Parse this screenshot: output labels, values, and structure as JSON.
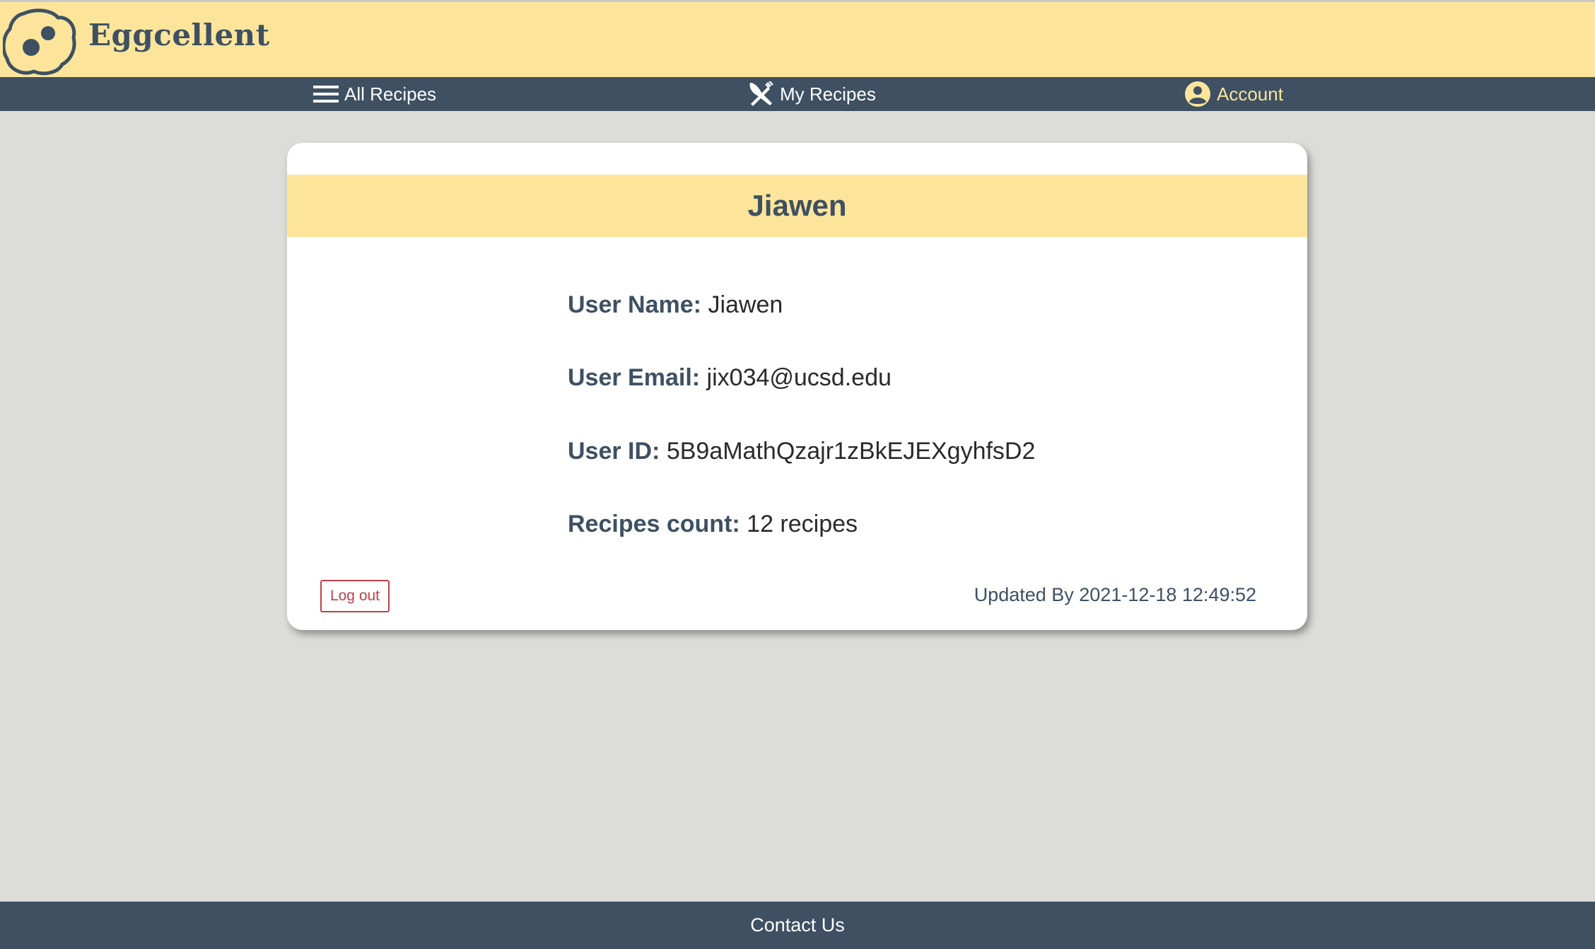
{
  "brand": {
    "name": "Eggcellent",
    "logo_icon": "egg-logo-icon"
  },
  "nav": {
    "items": [
      {
        "label": "All Recipes",
        "icon": "menu-icon",
        "active": false
      },
      {
        "label": "My Recipes",
        "icon": "utensils-icon",
        "active": false
      },
      {
        "label": "Account",
        "icon": "user-circle-icon",
        "active": true
      }
    ]
  },
  "profile": {
    "title": "Jiawen",
    "fields": [
      {
        "label": "User Name:",
        "value": "Jiawen"
      },
      {
        "label": "User Email:",
        "value": "jix034@ucsd.edu"
      },
      {
        "label": "User ID:",
        "value": "5B9aMathQzajr1zBkEJEXgyhfsD2"
      },
      {
        "label": "Recipes count:",
        "value": "12 recipes"
      }
    ],
    "logout_label": "Log out",
    "updated_text": "Updated By 2021-12-18 12:49:52"
  },
  "footer": {
    "contact_label": "Contact Us"
  },
  "colors": {
    "header_bg": "#fce59a",
    "nav_bg": "#3e5062",
    "page_bg": "#dcdcd8",
    "accent_active": "#fce59a",
    "logout": "#c0404a"
  }
}
